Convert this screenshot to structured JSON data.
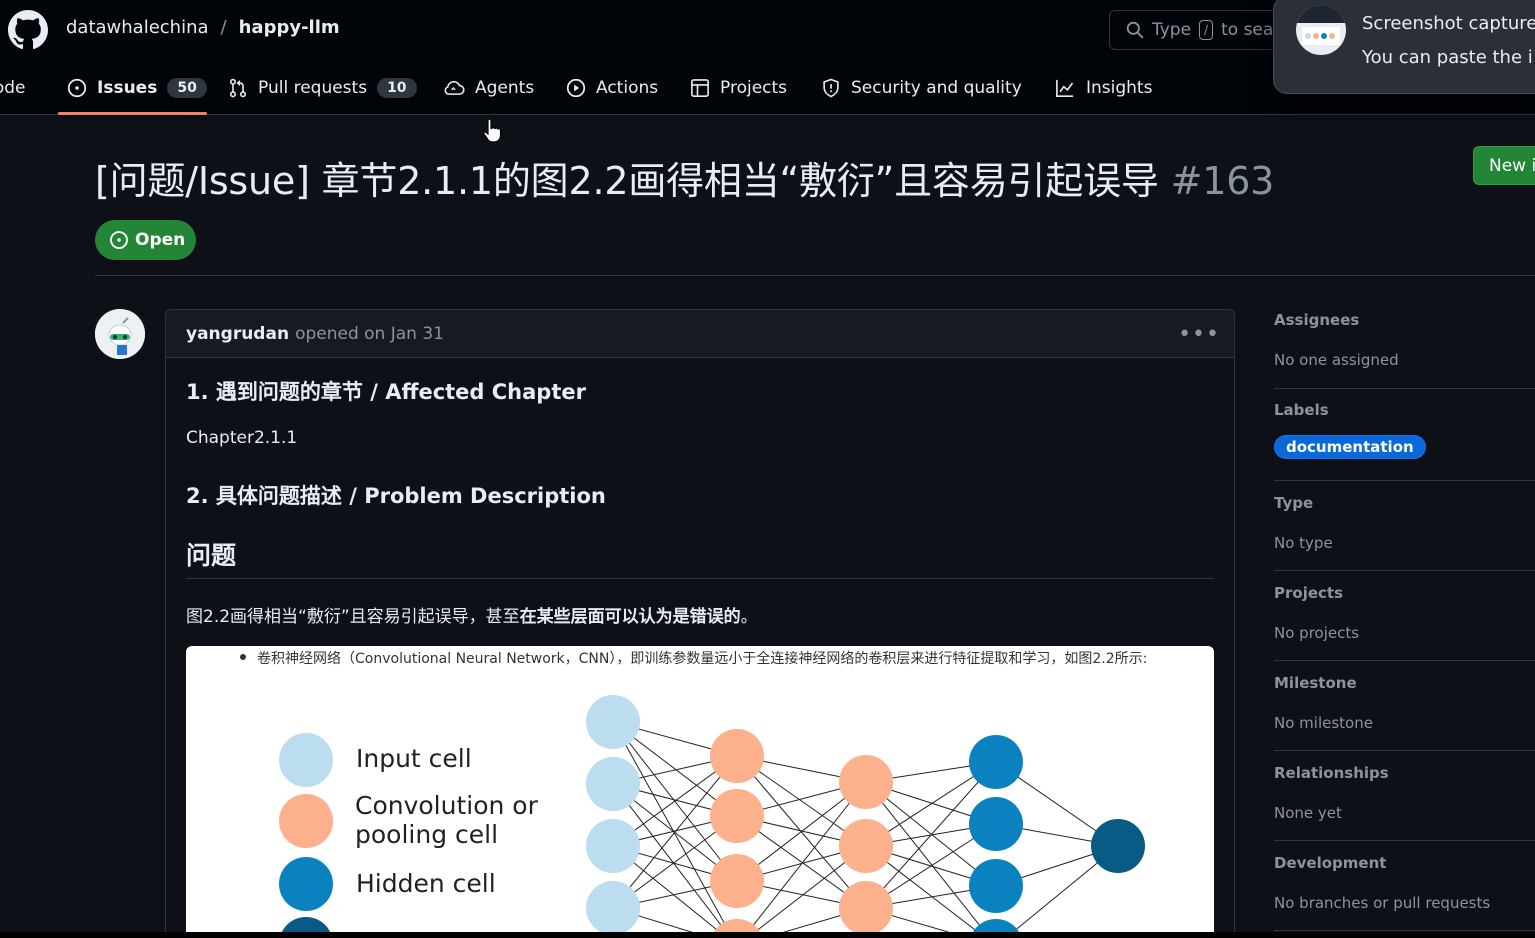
{
  "repo": {
    "owner": "datawhalechina",
    "separator": "/",
    "name": "happy-llm"
  },
  "search": {
    "prefix": "Type",
    "key": "/",
    "suffix": "to sea"
  },
  "toast": {
    "title": "Screenshot capture",
    "body": "You can paste the i"
  },
  "nav": {
    "code": "Code",
    "issues": "Issues",
    "issues_count": "50",
    "pulls": "Pull requests",
    "pulls_count": "10",
    "agents": "Agents",
    "actions": "Actions",
    "projects": "Projects",
    "security": "Security and quality",
    "insights": "Insights"
  },
  "issue": {
    "title": "[问题/Issue] 章节2.1.1的图2.2画得相当“敷衍”且容易引起误导",
    "number": "#163",
    "state": "Open",
    "new_issue_label": "New i"
  },
  "comment": {
    "author": "yangrudan",
    "meta": "opened on Jan 31",
    "h_affected": "1. 遇到问题的章节 / Affected Chapter",
    "chapter": "Chapter2.1.1",
    "h_problem": "2. 具体问题描述 / Problem Description",
    "h_issue": "问题",
    "desc_plain": "图2.2画得相当“敷衍”且容易引起误导，甚至",
    "desc_bold": "在某些层面可以认为是错误的",
    "desc_end": "。",
    "figure": {
      "caption": "卷积神经网络（Convolutional Neural Network，CNN），即训练参数量远小于全连接神经网络的卷积层来进行特征提取和学习，如图2.2所示:",
      "legend_input": "Input cell",
      "legend_conv_1": "Convolution or",
      "legend_conv_2": "pooling cell",
      "legend_hidden": "Hidden cell",
      "colors": {
        "input": "#bcdcf0",
        "conv": "#fcb08c",
        "hidden": "#0a82c0",
        "output": "#0a5a86"
      }
    }
  },
  "sidebar": {
    "assignees": {
      "title": "Assignees",
      "value": "No one assigned"
    },
    "labels": {
      "title": "Labels",
      "chip": "documentation"
    },
    "type": {
      "title": "Type",
      "value": "No type"
    },
    "projects": {
      "title": "Projects",
      "value": "No projects"
    },
    "milestone": {
      "title": "Milestone",
      "value": "No milestone"
    },
    "relationships": {
      "title": "Relationships",
      "value": "None yet"
    },
    "development": {
      "title": "Development",
      "value": "No branches or pull requests"
    }
  }
}
